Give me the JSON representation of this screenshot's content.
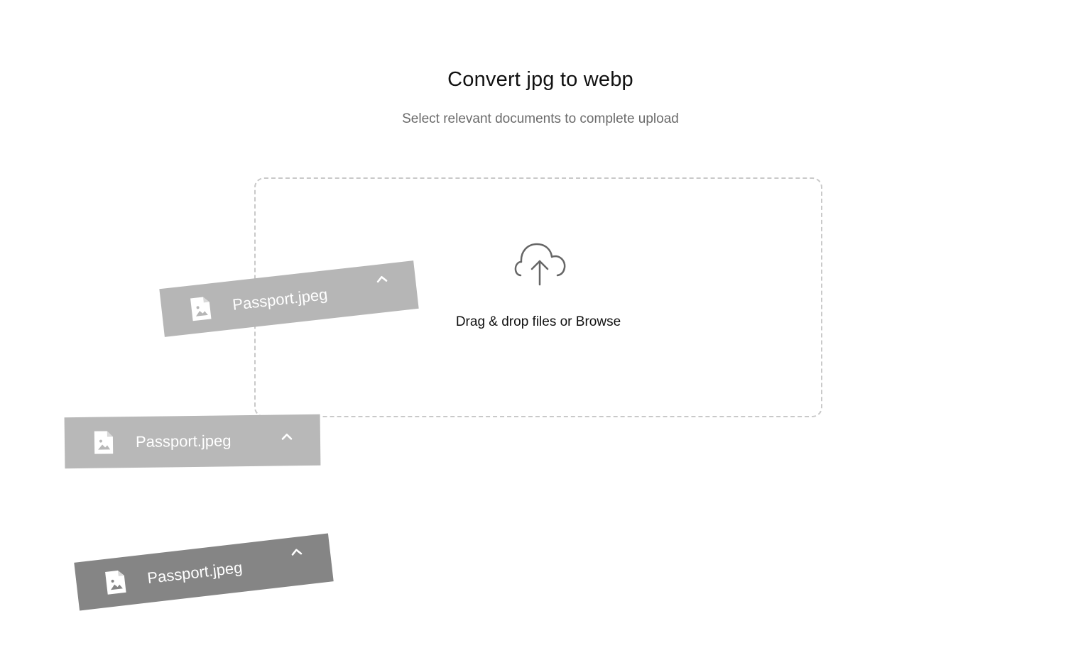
{
  "header": {
    "title": "Convert jpg to webp",
    "subtitle": "Select relevant documents to complete upload"
  },
  "dropzone": {
    "label": "Drag & drop files or Browse",
    "icon": "cloud-upload-icon"
  },
  "files": [
    {
      "name": "Passport.jpeg",
      "icon": "image-file-icon",
      "action_icon": "chevron-up-icon"
    },
    {
      "name": "Passport.jpeg",
      "icon": "image-file-icon",
      "action_icon": "chevron-up-icon"
    },
    {
      "name": "Passport.jpeg",
      "icon": "image-file-icon",
      "action_icon": "chevron-up-icon"
    }
  ],
  "colors": {
    "card_light": "#b6b6b6",
    "card_dark": "#858585",
    "dropzone_border": "#c9c9c9",
    "icon_stroke": "#666666"
  }
}
